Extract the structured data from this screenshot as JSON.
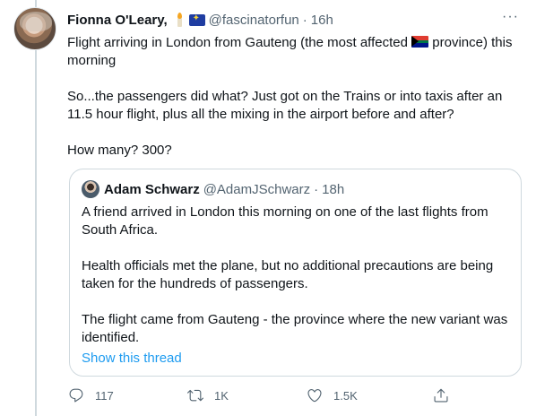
{
  "tweet": {
    "name": "Fionna O'Leary,",
    "handle": "@fascinatorfun",
    "separator": "·",
    "time": "16h",
    "more": "···",
    "line1_before": "Flight arriving in London from Gauteng (the most affected",
    "line1_after": "province) this morning",
    "para2": "So...the passengers did what?  Just got on the Trains or into taxis after an 11.5 hour flight, plus all the mixing in the airport before and after?",
    "para3": "How many?  300?",
    "emoji": {
      "after_name": [
        "candle-icon",
        "eu-flag-icon"
      ],
      "inline": "south-africa-flag-icon"
    }
  },
  "quote": {
    "name": "Adam Schwarz",
    "handle": "@AdamJSchwarz",
    "separator": "·",
    "time": "18h",
    "para1": "A friend arrived in London this morning on one of the last flights from South Africa.",
    "para2": "Health officials met the plane, but no additional precautions are being taken for the hundreds of passengers.",
    "para3": "The flight came from Gauteng - the province where the new variant was identified.",
    "show_thread": "Show this thread"
  },
  "actions": {
    "reply_count": "117",
    "retweet_count": "1K",
    "like_count": "1.5K",
    "icons": [
      "reply-icon",
      "retweet-icon",
      "like-icon",
      "share-icon"
    ]
  },
  "colors": {
    "text": "#0f1419",
    "secondary": "#536471",
    "link": "#1d9bf0",
    "border": "#cfd9de"
  }
}
